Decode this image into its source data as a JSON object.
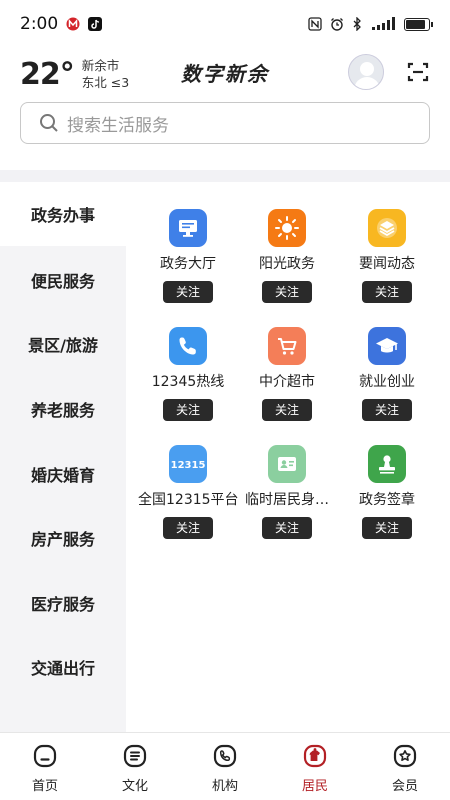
{
  "status_bar": {
    "time": "2:00"
  },
  "header": {
    "temperature": "22°",
    "city": "新余市",
    "wind": "东北 ≤3",
    "title": "数字新余"
  },
  "search": {
    "placeholder": "搜索生活服务"
  },
  "sidebar": {
    "items": [
      "政务办事",
      "便民服务",
      "景区/旅游",
      "养老服务",
      "婚庆婚育",
      "房产服务",
      "医疗服务",
      "交通出行"
    ],
    "active_index": 0
  },
  "services": [
    {
      "label": "政务大厅",
      "icon": "monitor-icon",
      "color": "#3f80e8",
      "action": "关注"
    },
    {
      "label": "阳光政务",
      "icon": "sun-icon",
      "color": "#f57a14",
      "action": "关注"
    },
    {
      "label": "要闻动态",
      "icon": "layers-icon",
      "color": "#f8b721",
      "action": "关注"
    },
    {
      "label": "12345热线",
      "icon": "phone-icon",
      "color": "#3c96ee",
      "action": "关注"
    },
    {
      "label": "中介超市",
      "icon": "cart-icon",
      "color": "#f47e58",
      "action": "关注"
    },
    {
      "label": "就业创业",
      "icon": "graduation-cap-icon",
      "color": "#3d73dd",
      "action": "关注"
    },
    {
      "label": "全国12315平台",
      "icon": "badge-12315-icon",
      "color": "#4a9ef0",
      "action": "关注"
    },
    {
      "label": "临时居民身…",
      "icon": "id-card-icon",
      "color": "#8bcf9f",
      "action": "关注"
    },
    {
      "label": "政务签章",
      "icon": "stamp-icon",
      "color": "#3fa54b",
      "action": "关注"
    }
  ],
  "bottom_nav": {
    "items": [
      "首页",
      "文化",
      "机构",
      "居民",
      "会员"
    ],
    "active_index": 3,
    "active_color": "#b32025"
  }
}
